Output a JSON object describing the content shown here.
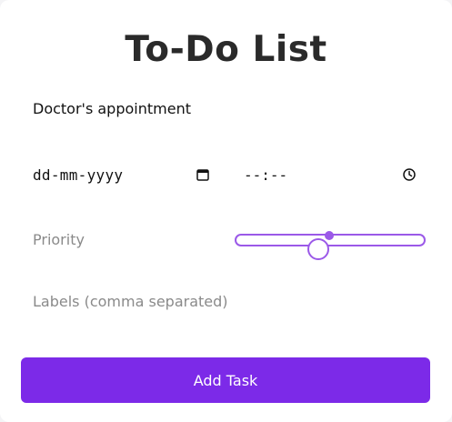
{
  "header": {
    "title": "To-Do List"
  },
  "form": {
    "task_name_value": "Doctor's appointment",
    "date_value": "dd-mm-yyyy",
    "date_icon": "calendar-icon",
    "time_value": "--:--",
    "time_icon": "clock-icon",
    "priority_label": "Priority",
    "priority_level_fraction": 0.5,
    "labels_placeholder": "Labels (comma separated)",
    "submit_label": "Add Task"
  },
  "colors": {
    "accent": "#7c2ae8",
    "slider": "#9b59e8",
    "title": "#2a2a2a",
    "placeholder": "#8a8a8a"
  }
}
